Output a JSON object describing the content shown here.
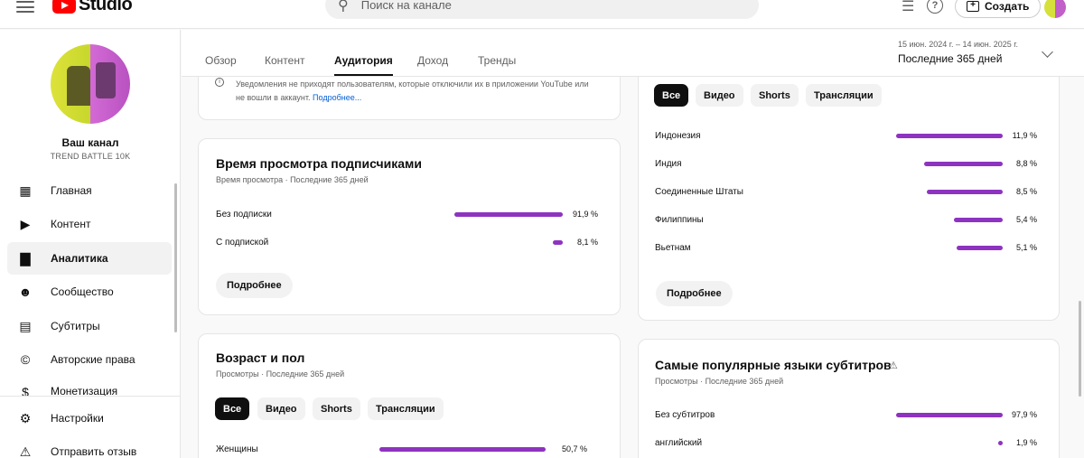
{
  "topbar": {
    "logo_text": "Studio",
    "search_placeholder": "Поиск на канале",
    "create_label": "Создать"
  },
  "channel": {
    "name": "Ваш канал",
    "handle": "TREND BATTLE 10K"
  },
  "sidebar": {
    "items": [
      {
        "label": "Главная",
        "icon": "dashboard-icon"
      },
      {
        "label": "Контент",
        "icon": "content-icon"
      },
      {
        "label": "Аналитика",
        "icon": "analytics-icon",
        "active": true
      },
      {
        "label": "Сообщество",
        "icon": "community-icon"
      },
      {
        "label": "Субтитры",
        "icon": "subtitles-icon"
      },
      {
        "label": "Авторские права",
        "icon": "copyright-icon"
      },
      {
        "label": "Монетизация",
        "icon": "monetization-icon"
      }
    ],
    "bottom": [
      {
        "label": "Настройки",
        "icon": "gear-icon"
      },
      {
        "label": "Отправить отзыв",
        "icon": "feedback-icon"
      }
    ]
  },
  "tabs": [
    "Обзор",
    "Контент",
    "Аудитория",
    "Доход",
    "Тренды"
  ],
  "active_tab": "Аудитория",
  "date": {
    "range": "15 июн. 2024 г. – 14 июн. 2025 г.",
    "period": "Последние 365 дней"
  },
  "notice": {
    "text": "Уведомления не приходят пользователям, которые отключили их в приложении YouTube или не вошли в аккаунт.",
    "link": "Подробнее..."
  },
  "subscribers_card": {
    "title": "Время просмотра подписчиками",
    "subtitle": "Время просмотра · Последние 365 дней",
    "rows": [
      {
        "label": "Без подписки",
        "pct": "91,9 %",
        "value": 91.9
      },
      {
        "label": "С подпиской",
        "pct": "8,1 %",
        "value": 8.1
      }
    ],
    "more_label": "Подробнее"
  },
  "age_card": {
    "title": "Возраст и пол",
    "subtitle": "Просмотры · Последние 365 дней",
    "chips": [
      "Все",
      "Видео",
      "Shorts",
      "Трансляции"
    ],
    "rows": [
      {
        "label": "Женщины",
        "pct": "50,7 %",
        "value": 50.7
      }
    ]
  },
  "geo_card": {
    "chips": [
      "Все",
      "Видео",
      "Shorts",
      "Трансляции"
    ],
    "rows": [
      {
        "label": "Индонезия",
        "pct": "11,9 %",
        "value": 11.9
      },
      {
        "label": "Индия",
        "pct": "8,8 %",
        "value": 8.8
      },
      {
        "label": "Соединенные Штаты",
        "pct": "8,5 %",
        "value": 8.5
      },
      {
        "label": "Филиппины",
        "pct": "5,4 %",
        "value": 5.4
      },
      {
        "label": "Вьетнам",
        "pct": "5,1 %",
        "value": 5.1
      }
    ],
    "more_label": "Подробнее"
  },
  "subs_lang_card": {
    "title": "Самые популярные языки субтитров",
    "subtitle": "Просмотры · Последние 365 дней",
    "rows": [
      {
        "label": "Без субтитров",
        "pct": "97,9 %",
        "value": 97.9
      },
      {
        "label": "английский",
        "pct": "1,9 %",
        "value": 1.9
      }
    ]
  },
  "colors": {
    "bar": "#8e33c0",
    "accent": "#ff0000"
  }
}
